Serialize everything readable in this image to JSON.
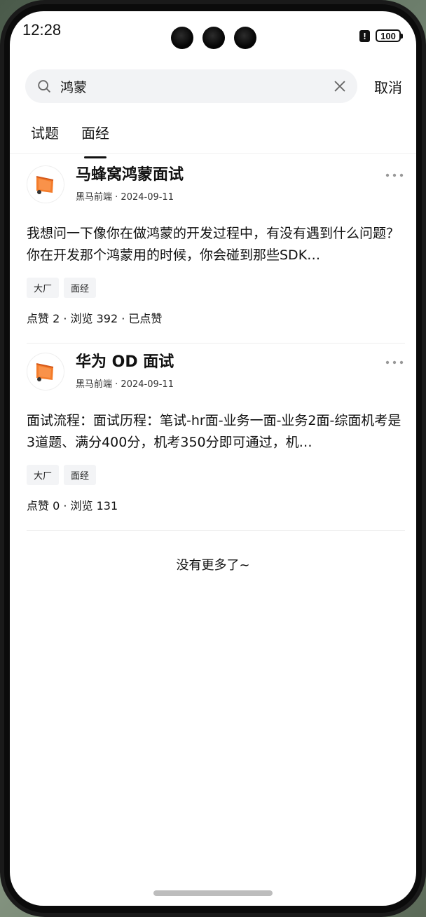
{
  "status": {
    "time": "12:28",
    "battery": "100",
    "alert_glyph": "!"
  },
  "search": {
    "value": "鸿蒙",
    "cancel_label": "取消"
  },
  "tabs": [
    {
      "label": "试题",
      "active": false
    },
    {
      "label": "面经",
      "active": true
    }
  ],
  "posts": [
    {
      "title": "马蜂窝鸿蒙面试",
      "author": "黑马前端",
      "date": "2024-09-11",
      "body": "我想问一下像你在做鸿蒙的开发过程中，有没有遇到什么问题？你在开发那个鸿蒙用的时候，你会碰到那些SDK…",
      "tags": [
        "大厂",
        "面经"
      ],
      "stats": "点赞 2 · 浏览 392 · 已点赞"
    },
    {
      "title": "华为 OD 面试",
      "author": "黑马前端",
      "date": "2024-09-11",
      "body": "面试流程：面试历程：笔试-hr面-业务一面-业务2面-综面机考是3道题、满分400分，机考350分即可通过，机…",
      "tags": [
        "大厂",
        "面经"
      ],
      "stats": "点赞 0 · 浏览 131"
    }
  ],
  "footer": {
    "no_more": "没有更多了~"
  },
  "colors": {
    "accent_orange": "#f47c2a",
    "search_bg": "#f2f3f5",
    "tag_bg": "#f3f4f6"
  },
  "icons": [
    "search-icon",
    "close-icon",
    "more-icon",
    "avatar-logo-icon"
  ]
}
